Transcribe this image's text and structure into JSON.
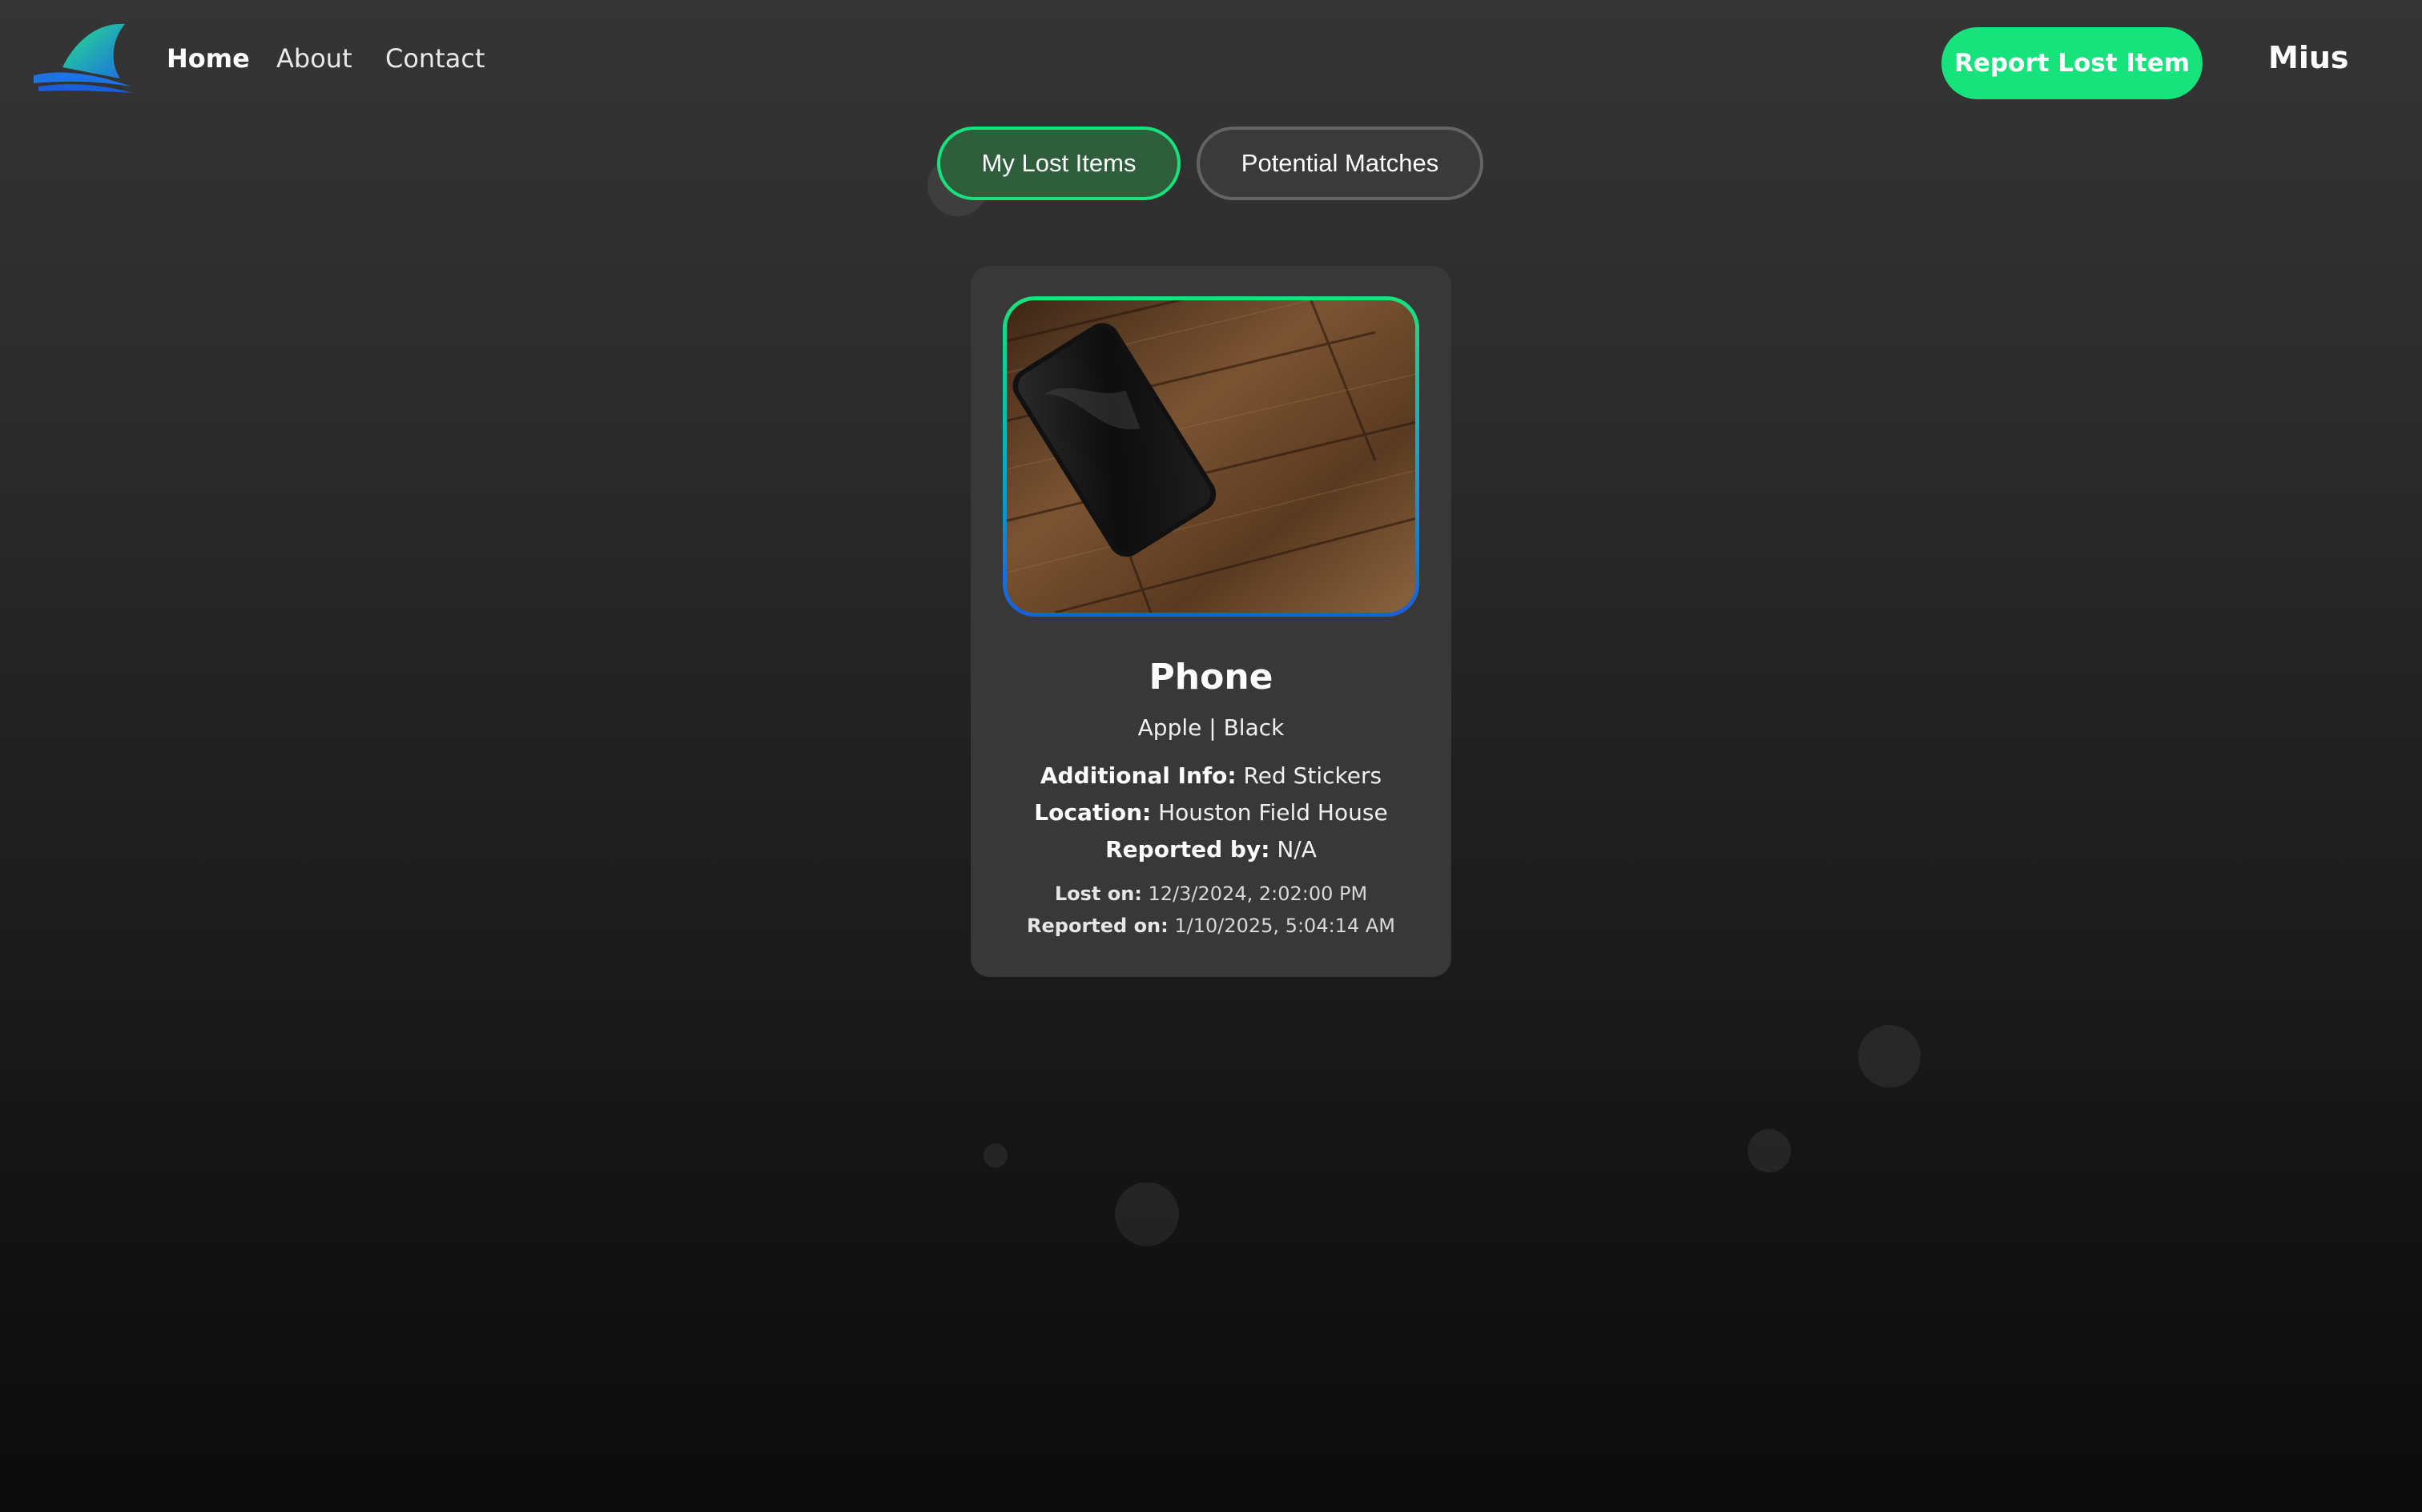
{
  "nav": {
    "logo_icon": "shark-fin-logo-icon",
    "links": [
      {
        "label": "Home",
        "active": true
      },
      {
        "label": "About",
        "active": false
      },
      {
        "label": "Contact",
        "active": false
      }
    ],
    "report_button_label": "Report Lost Item",
    "user_name": "Mius"
  },
  "tabs": [
    {
      "label": "My Lost Items",
      "active": true
    },
    {
      "label": "Potential Matches",
      "active": false
    }
  ],
  "item": {
    "image_alt": "phone-photo",
    "title": "Phone",
    "subtitle": "Apple | Black",
    "additional_info_label": "Additional Info:",
    "additional_info_value": "Red Stickers",
    "location_label": "Location:",
    "location_value": "Houston Field House",
    "reported_by_label": "Reported by:",
    "reported_by_value": "N/A",
    "lost_on_label": "Lost on:",
    "lost_on_value": "12/3/2024, 2:02:00 PM",
    "reported_on_label": "Reported on:",
    "reported_on_value": "1/10/2025, 5:04:14 AM"
  },
  "colors": {
    "accent_green": "#17e37c",
    "accent_blue": "#1a5fd9",
    "card_bg": "#383838"
  }
}
